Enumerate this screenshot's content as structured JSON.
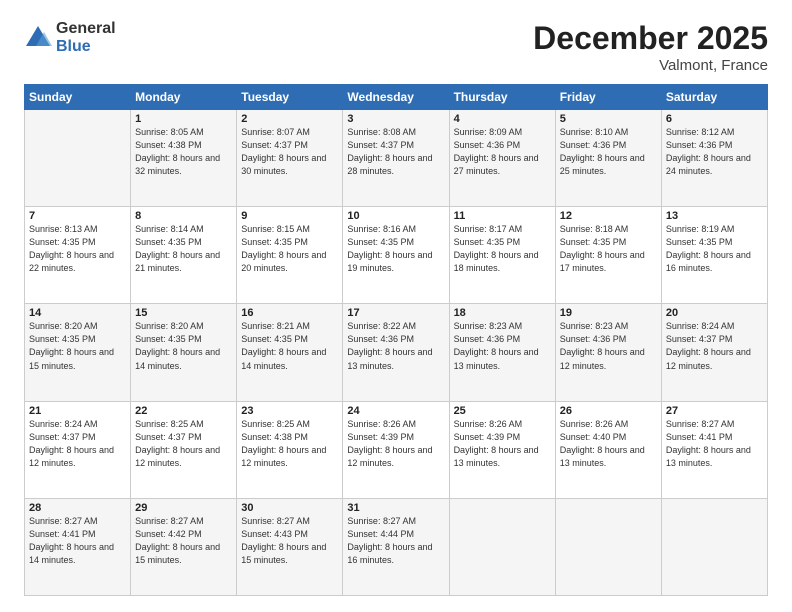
{
  "logo": {
    "general": "General",
    "blue": "Blue"
  },
  "title": "December 2025",
  "location": "Valmont, France",
  "days_header": [
    "Sunday",
    "Monday",
    "Tuesday",
    "Wednesday",
    "Thursday",
    "Friday",
    "Saturday"
  ],
  "weeks": [
    [
      {
        "day": "",
        "sunrise": "",
        "sunset": "",
        "daylight": ""
      },
      {
        "day": "1",
        "sunrise": "Sunrise: 8:05 AM",
        "sunset": "Sunset: 4:38 PM",
        "daylight": "Daylight: 8 hours and 32 minutes."
      },
      {
        "day": "2",
        "sunrise": "Sunrise: 8:07 AM",
        "sunset": "Sunset: 4:37 PM",
        "daylight": "Daylight: 8 hours and 30 minutes."
      },
      {
        "day": "3",
        "sunrise": "Sunrise: 8:08 AM",
        "sunset": "Sunset: 4:37 PM",
        "daylight": "Daylight: 8 hours and 28 minutes."
      },
      {
        "day": "4",
        "sunrise": "Sunrise: 8:09 AM",
        "sunset": "Sunset: 4:36 PM",
        "daylight": "Daylight: 8 hours and 27 minutes."
      },
      {
        "day": "5",
        "sunrise": "Sunrise: 8:10 AM",
        "sunset": "Sunset: 4:36 PM",
        "daylight": "Daylight: 8 hours and 25 minutes."
      },
      {
        "day": "6",
        "sunrise": "Sunrise: 8:12 AM",
        "sunset": "Sunset: 4:36 PM",
        "daylight": "Daylight: 8 hours and 24 minutes."
      }
    ],
    [
      {
        "day": "7",
        "sunrise": "Sunrise: 8:13 AM",
        "sunset": "Sunset: 4:35 PM",
        "daylight": "Daylight: 8 hours and 22 minutes."
      },
      {
        "day": "8",
        "sunrise": "Sunrise: 8:14 AM",
        "sunset": "Sunset: 4:35 PM",
        "daylight": "Daylight: 8 hours and 21 minutes."
      },
      {
        "day": "9",
        "sunrise": "Sunrise: 8:15 AM",
        "sunset": "Sunset: 4:35 PM",
        "daylight": "Daylight: 8 hours and 20 minutes."
      },
      {
        "day": "10",
        "sunrise": "Sunrise: 8:16 AM",
        "sunset": "Sunset: 4:35 PM",
        "daylight": "Daylight: 8 hours and 19 minutes."
      },
      {
        "day": "11",
        "sunrise": "Sunrise: 8:17 AM",
        "sunset": "Sunset: 4:35 PM",
        "daylight": "Daylight: 8 hours and 18 minutes."
      },
      {
        "day": "12",
        "sunrise": "Sunrise: 8:18 AM",
        "sunset": "Sunset: 4:35 PM",
        "daylight": "Daylight: 8 hours and 17 minutes."
      },
      {
        "day": "13",
        "sunrise": "Sunrise: 8:19 AM",
        "sunset": "Sunset: 4:35 PM",
        "daylight": "Daylight: 8 hours and 16 minutes."
      }
    ],
    [
      {
        "day": "14",
        "sunrise": "Sunrise: 8:20 AM",
        "sunset": "Sunset: 4:35 PM",
        "daylight": "Daylight: 8 hours and 15 minutes."
      },
      {
        "day": "15",
        "sunrise": "Sunrise: 8:20 AM",
        "sunset": "Sunset: 4:35 PM",
        "daylight": "Daylight: 8 hours and 14 minutes."
      },
      {
        "day": "16",
        "sunrise": "Sunrise: 8:21 AM",
        "sunset": "Sunset: 4:35 PM",
        "daylight": "Daylight: 8 hours and 14 minutes."
      },
      {
        "day": "17",
        "sunrise": "Sunrise: 8:22 AM",
        "sunset": "Sunset: 4:36 PM",
        "daylight": "Daylight: 8 hours and 13 minutes."
      },
      {
        "day": "18",
        "sunrise": "Sunrise: 8:23 AM",
        "sunset": "Sunset: 4:36 PM",
        "daylight": "Daylight: 8 hours and 13 minutes."
      },
      {
        "day": "19",
        "sunrise": "Sunrise: 8:23 AM",
        "sunset": "Sunset: 4:36 PM",
        "daylight": "Daylight: 8 hours and 12 minutes."
      },
      {
        "day": "20",
        "sunrise": "Sunrise: 8:24 AM",
        "sunset": "Sunset: 4:37 PM",
        "daylight": "Daylight: 8 hours and 12 minutes."
      }
    ],
    [
      {
        "day": "21",
        "sunrise": "Sunrise: 8:24 AM",
        "sunset": "Sunset: 4:37 PM",
        "daylight": "Daylight: 8 hours and 12 minutes."
      },
      {
        "day": "22",
        "sunrise": "Sunrise: 8:25 AM",
        "sunset": "Sunset: 4:37 PM",
        "daylight": "Daylight: 8 hours and 12 minutes."
      },
      {
        "day": "23",
        "sunrise": "Sunrise: 8:25 AM",
        "sunset": "Sunset: 4:38 PM",
        "daylight": "Daylight: 8 hours and 12 minutes."
      },
      {
        "day": "24",
        "sunrise": "Sunrise: 8:26 AM",
        "sunset": "Sunset: 4:39 PM",
        "daylight": "Daylight: 8 hours and 12 minutes."
      },
      {
        "day": "25",
        "sunrise": "Sunrise: 8:26 AM",
        "sunset": "Sunset: 4:39 PM",
        "daylight": "Daylight: 8 hours and 13 minutes."
      },
      {
        "day": "26",
        "sunrise": "Sunrise: 8:26 AM",
        "sunset": "Sunset: 4:40 PM",
        "daylight": "Daylight: 8 hours and 13 minutes."
      },
      {
        "day": "27",
        "sunrise": "Sunrise: 8:27 AM",
        "sunset": "Sunset: 4:41 PM",
        "daylight": "Daylight: 8 hours and 13 minutes."
      }
    ],
    [
      {
        "day": "28",
        "sunrise": "Sunrise: 8:27 AM",
        "sunset": "Sunset: 4:41 PM",
        "daylight": "Daylight: 8 hours and 14 minutes."
      },
      {
        "day": "29",
        "sunrise": "Sunrise: 8:27 AM",
        "sunset": "Sunset: 4:42 PM",
        "daylight": "Daylight: 8 hours and 15 minutes."
      },
      {
        "day": "30",
        "sunrise": "Sunrise: 8:27 AM",
        "sunset": "Sunset: 4:43 PM",
        "daylight": "Daylight: 8 hours and 15 minutes."
      },
      {
        "day": "31",
        "sunrise": "Sunrise: 8:27 AM",
        "sunset": "Sunset: 4:44 PM",
        "daylight": "Daylight: 8 hours and 16 minutes."
      },
      {
        "day": "",
        "sunrise": "",
        "sunset": "",
        "daylight": ""
      },
      {
        "day": "",
        "sunrise": "",
        "sunset": "",
        "daylight": ""
      },
      {
        "day": "",
        "sunrise": "",
        "sunset": "",
        "daylight": ""
      }
    ]
  ]
}
